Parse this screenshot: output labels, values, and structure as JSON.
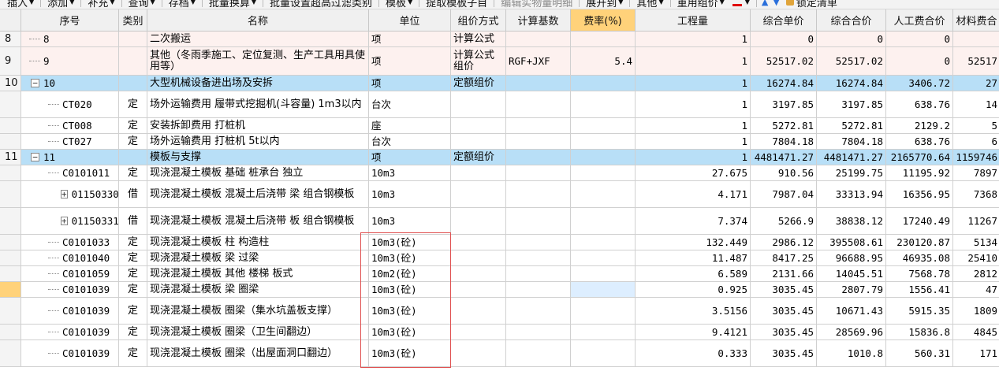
{
  "toolbar": {
    "items": [
      {
        "label": "插入",
        "dropdown": true
      },
      {
        "label": "添加",
        "dropdown": true
      },
      {
        "label": "补充",
        "dropdown": true
      },
      {
        "label": "查询",
        "dropdown": true
      },
      {
        "label": "存档",
        "dropdown": true
      },
      {
        "label": "批量换算",
        "dropdown": true
      },
      {
        "label": "批量设置超高过滤类别",
        "dropdown": false
      },
      {
        "label": "模板",
        "dropdown": true
      },
      {
        "label": "提取模板子目",
        "dropdown": false
      },
      {
        "label": "编辑实物量明细",
        "dropdown": false,
        "disabled": true
      },
      {
        "label": "展开到",
        "dropdown": true
      },
      {
        "label": "其他",
        "dropdown": true
      },
      {
        "label": "重用组价",
        "dropdown": true
      },
      {
        "label": "锁定清单",
        "dropdown": false
      }
    ]
  },
  "headers": [
    "序号",
    "类别",
    "名称",
    "单位",
    "组价方式",
    "计算基数",
    "费率(%)",
    "工程量",
    "综合单价",
    "综合合价",
    "人工费合价",
    "材料费合"
  ],
  "rows": [
    {
      "style": "pink",
      "gutter": "8",
      "code": "8",
      "type": "",
      "name": "二次搬运",
      "unit": "项",
      "method": "计算公式",
      "base": "",
      "rate": "",
      "qty": "1",
      "price": "0",
      "total": "0",
      "labor": "0",
      "material": ""
    },
    {
      "style": "pink",
      "gutter": "9",
      "code": "9",
      "type": "",
      "name": "其他（冬雨季施工、定位复测、生产工具用具使用等）",
      "unit": "项",
      "method": "计算公式组价",
      "base": "RGF+JXF",
      "rate": "5.4",
      "qty": "1",
      "price": "52517.02",
      "total": "52517.02",
      "labor": "0",
      "material": "52517"
    },
    {
      "style": "blue",
      "gutter": "10",
      "code": "10",
      "expander": "−",
      "type": "",
      "name": "大型机械设备进出场及安拆",
      "unit": "项",
      "method": "定额组价",
      "base": "",
      "rate": "",
      "qty": "1",
      "price": "16274.84",
      "total": "16274.84",
      "labor": "3406.72",
      "material": "27"
    },
    {
      "style": "",
      "gutter": "",
      "code": "CT020",
      "type": "定",
      "name": "场外运输费用 履带式挖掘机(斗容量) 1m3以内",
      "unit": "台次",
      "method": "",
      "base": "",
      "rate": "",
      "qty": "1",
      "price": "3197.85",
      "total": "3197.85",
      "labor": "638.76",
      "material": "14"
    },
    {
      "style": "",
      "gutter": "",
      "code": "CT008",
      "type": "定",
      "name": "安装拆卸费用 打桩机",
      "unit": "座",
      "method": "",
      "base": "",
      "rate": "",
      "qty": "1",
      "price": "5272.81",
      "total": "5272.81",
      "labor": "2129.2",
      "material": "5"
    },
    {
      "style": "",
      "gutter": "",
      "code": "CT027",
      "type": "定",
      "name": "场外运输费用 打桩机 5t以内",
      "unit": "台次",
      "method": "",
      "base": "",
      "rate": "",
      "qty": "1",
      "price": "7804.18",
      "total": "7804.18",
      "labor": "638.76",
      "material": "6"
    },
    {
      "style": "blue",
      "gutter": "11",
      "code": "11",
      "expander": "−",
      "type": "",
      "name": "模板与支撑",
      "unit": "项",
      "method": "定额组价",
      "base": "",
      "rate": "",
      "qty": "1",
      "price": "4481471.27",
      "total": "4481471.27",
      "labor": "2165770.64",
      "material": "1159746"
    },
    {
      "style": "",
      "gutter": "",
      "code": "C0101011",
      "type": "定",
      "name": "现浇混凝土模板 基础 桩承台 独立",
      "unit": "10m3",
      "method": "",
      "base": "",
      "rate": "",
      "qty": "27.675",
      "price": "910.56",
      "total": "25199.75",
      "labor": "11195.92",
      "material": "7897"
    },
    {
      "style": "",
      "gutter": "",
      "code": "01150330",
      "expander": "+",
      "type": "借",
      "name": "现浇混凝土模板 混凝土后浇带 梁 组合钢模板",
      "unit": "10m3",
      "method": "",
      "base": "",
      "rate": "",
      "qty": "4.171",
      "price": "7987.04",
      "total": "33313.94",
      "labor": "16356.95",
      "material": "7368"
    },
    {
      "style": "",
      "gutter": "",
      "code": "01150331",
      "expander": "+",
      "type": "借",
      "name": "现浇混凝土模板 混凝土后浇带 板 组合钢模板",
      "unit": "10m3",
      "method": "",
      "base": "",
      "rate": "",
      "qty": "7.374",
      "price": "5266.9",
      "total": "38838.12",
      "labor": "17240.49",
      "material": "11267"
    },
    {
      "style": "",
      "gutter": "",
      "code": "C0101033",
      "type": "定",
      "name": "现浇混凝土模板 柱 构造柱",
      "unit": "10m3(砼)",
      "method": "",
      "base": "",
      "rate": "",
      "qty": "132.449",
      "price": "2986.12",
      "total": "395508.61",
      "labor": "230120.87",
      "material": "5134"
    },
    {
      "style": "",
      "gutter": "",
      "code": "C0101040",
      "type": "定",
      "name": "现浇混凝土模板 梁 过梁",
      "unit": "10m3(砼)",
      "method": "",
      "base": "",
      "rate": "",
      "qty": "11.487",
      "price": "8417.25",
      "total": "96688.95",
      "labor": "46935.08",
      "material": "25410"
    },
    {
      "style": "",
      "gutter": "",
      "code": "C0101059",
      "type": "定",
      "name": "现浇混凝土模板 其他 楼梯 板式",
      "unit": "10m2(砼)",
      "method": "",
      "base": "",
      "rate": "",
      "qty": "6.589",
      "price": "2131.66",
      "total": "14045.51",
      "labor": "7568.78",
      "material": "2812"
    },
    {
      "style": "",
      "gutter": "",
      "gutter_sel": true,
      "rate_hl": true,
      "code": "C0101039",
      "type": "定",
      "name": "现浇混凝土模板 梁 圈梁",
      "unit": "10m3(砼)",
      "method": "",
      "base": "",
      "rate": "",
      "qty": "0.925",
      "price": "3035.45",
      "total": "2807.79",
      "labor": "1556.41",
      "material": "47"
    },
    {
      "style": "",
      "gutter": "",
      "code": "C0101039",
      "type": "定",
      "name": "现浇混凝土模板  圈梁（集水坑盖板支撑）",
      "unit": "10m3(砼)",
      "method": "",
      "base": "",
      "rate": "",
      "qty": "3.5156",
      "price": "3035.45",
      "total": "10671.43",
      "labor": "5915.35",
      "material": "1809"
    },
    {
      "style": "",
      "gutter": "",
      "code": "C0101039",
      "type": "定",
      "name": "现浇混凝土模板  圈梁（卫生间翻边）",
      "unit": "10m3(砼)",
      "method": "",
      "base": "",
      "rate": "",
      "qty": "9.4121",
      "price": "3035.45",
      "total": "28569.96",
      "labor": "15836.8",
      "material": "4845"
    },
    {
      "style": "",
      "gutter": "",
      "code": "C0101039",
      "type": "定",
      "name": "现浇混凝土模板  圈梁（出屋面洞口翻边）",
      "unit": "10m3(砼)",
      "method": "",
      "base": "",
      "rate": "",
      "qty": "0.333",
      "price": "3035.45",
      "total": "1010.8",
      "labor": "560.31",
      "material": "171"
    }
  ]
}
